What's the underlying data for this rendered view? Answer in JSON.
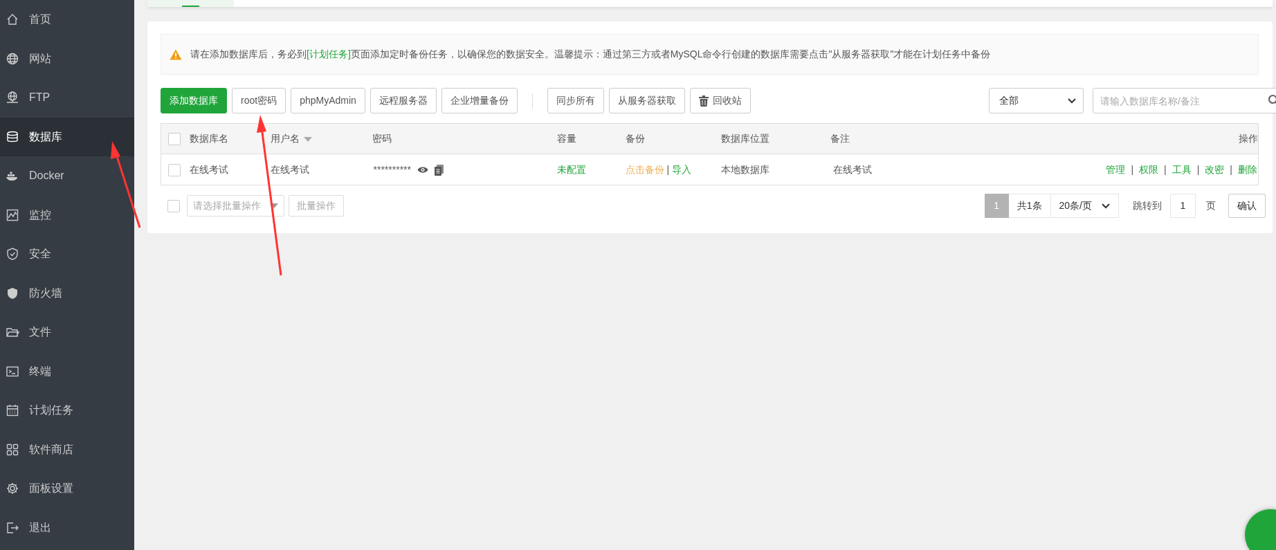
{
  "sidebar": {
    "items": [
      {
        "label": "首页",
        "selected": false
      },
      {
        "label": "网站",
        "selected": false
      },
      {
        "label": "FTP",
        "selected": false
      },
      {
        "label": "数据库",
        "selected": true
      },
      {
        "label": "Docker",
        "selected": false
      },
      {
        "label": "监控",
        "selected": false
      },
      {
        "label": "安全",
        "selected": false
      },
      {
        "label": "防火墙",
        "selected": false
      },
      {
        "label": "文件",
        "selected": false
      },
      {
        "label": "终端",
        "selected": false
      },
      {
        "label": "计划任务",
        "selected": false
      },
      {
        "label": "软件商店",
        "selected": false
      },
      {
        "label": "面板设置",
        "selected": false
      },
      {
        "label": "退出",
        "selected": false
      }
    ]
  },
  "alert": {
    "text_before": "请在添加数据库后，务必到",
    "link": "[计划任务]",
    "text_after": "页面添加定时备份任务，以确保您的数据安全。温馨提示：通过第三方或者MySQL命令行创建的数据库需要点击\"从服务器获取\"才能在计划任务中备份"
  },
  "toolbar": {
    "left_buttons": [
      {
        "label": "添加数据库",
        "kind": "primary"
      },
      {
        "label": "root密码",
        "kind": "default"
      },
      {
        "label": "phpMyAdmin",
        "kind": "default"
      },
      {
        "label": "远程服务器",
        "kind": "default"
      },
      {
        "label": "企业增量备份",
        "kind": "default"
      }
    ],
    "right_buttons": [
      {
        "label": "同步所有",
        "kind": "default"
      },
      {
        "label": "从服务器获取",
        "kind": "default"
      },
      {
        "label": "回收站",
        "kind": "trash"
      }
    ],
    "filter": {
      "value": "全部"
    },
    "search": {
      "placeholder": "请输入数据库名称/备注"
    }
  },
  "table": {
    "select_all": {
      "checked": false
    },
    "columns": [
      {
        "label": "数据库名",
        "sortable": false
      },
      {
        "label": "用户名",
        "sortable": true
      },
      {
        "label": "密码",
        "sortable": false
      },
      {
        "label": "容量",
        "sortable": false
      },
      {
        "label": "备份",
        "sortable": false
      },
      {
        "label": "数据库位置",
        "sortable": false
      },
      {
        "label": "备注",
        "sortable": false
      },
      {
        "label": "操作",
        "sortable": false
      }
    ],
    "rows": [
      {
        "checked": false,
        "name": "在线考试",
        "user": "在线考试",
        "password": "**********",
        "capacity": "未配置",
        "backup": "点击备份",
        "backup_divider": "|",
        "import": "导入",
        "location": "本地数据库",
        "note": "在线考试",
        "actions": [
          {
            "kind": "link",
            "text": "管理"
          },
          {
            "kind": "divider",
            "text": "|"
          },
          {
            "kind": "link",
            "text": "权限"
          },
          {
            "kind": "divider",
            "text": "|"
          },
          {
            "kind": "link",
            "text": "工具"
          },
          {
            "kind": "divider",
            "text": "|"
          },
          {
            "kind": "link",
            "text": "改密"
          },
          {
            "kind": "divider",
            "text": "|"
          },
          {
            "kind": "link",
            "text": "删除"
          }
        ]
      }
    ]
  },
  "footer": {
    "batch_checkbox": {
      "checked": false
    },
    "batch_select": {
      "placeholder": "请选择批量操作"
    },
    "batch_button": {
      "label": "批量操作",
      "disabled": true
    },
    "pagination": {
      "current": "1",
      "total": "共1条",
      "per_page": "20条/页",
      "jump_label": "跳转到",
      "jump_value": "1",
      "unit": "页",
      "confirm": "确认"
    }
  }
}
